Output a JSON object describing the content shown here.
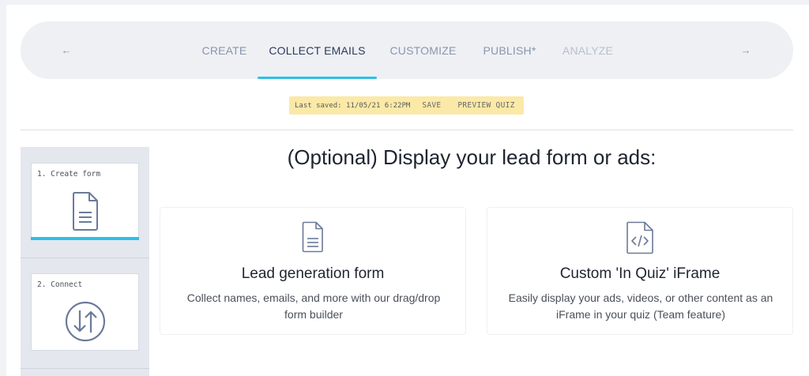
{
  "nav": {
    "back_arrow": "←",
    "forward_arrow": "→",
    "tabs": [
      {
        "label": "CREATE",
        "state": "normal"
      },
      {
        "label": "COLLECT EMAILS",
        "state": "active"
      },
      {
        "label": "CUSTOMIZE",
        "state": "normal"
      },
      {
        "label": "PUBLISH*",
        "state": "normal"
      },
      {
        "label": "ANALYZE",
        "state": "disabled"
      }
    ]
  },
  "savebar": {
    "last_saved": "Last saved: 11/05/21 6:22PM",
    "save_label": "SAVE",
    "preview_label": "PREVIEW QUIZ"
  },
  "steps": {
    "items": [
      {
        "label": "1. Create form",
        "icon": "document-icon",
        "active": true
      },
      {
        "label": "2. Connect",
        "icon": "sync-arrows-icon",
        "active": false
      }
    ]
  },
  "main": {
    "heading": "(Optional) Display your lead form or ads:",
    "cards": [
      {
        "title": "Lead generation form",
        "description": "Collect names, emails, and more with our drag/drop form builder",
        "icon": "document-icon"
      },
      {
        "title": "Custom 'In Quiz' iFrame",
        "description": "Easily display your ads, videos, or other content as an iFrame in your quiz (Team feature)",
        "icon": "code-file-icon"
      }
    ]
  },
  "colors": {
    "accent": "#2cc0e6",
    "active_tab": "#2b3a5c",
    "tab": "#8a95ad",
    "disabled_tab": "#b9bfcc",
    "savebar_bg": "#fbe9a7",
    "icon_stroke": "#6b7a99"
  }
}
